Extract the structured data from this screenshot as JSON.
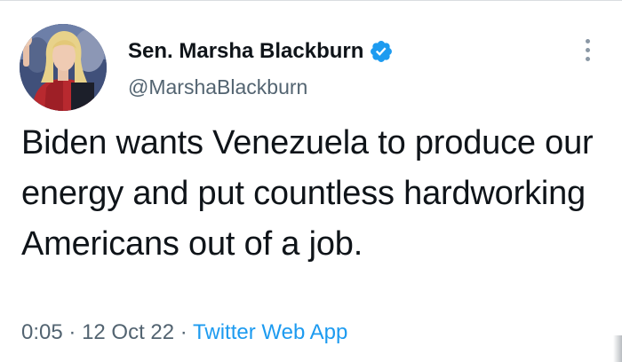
{
  "author": {
    "display_name": "Sen. Marsha Blackburn",
    "handle": "@MarshaBlackburn",
    "verified": true,
    "avatar_icon": "profile-photo"
  },
  "tweet": {
    "text": "Biden wants Venezuela to produce our energy and put countless hardworking Americans out of a job.",
    "time": "0:05",
    "separator": "·",
    "date": "12 Oct 22",
    "source": "Twitter Web App"
  },
  "menu": {
    "icon": "more-vertical-icon"
  },
  "colors": {
    "text": "#0f1419",
    "secondary": "#536471",
    "accent": "#1d9bf0"
  }
}
